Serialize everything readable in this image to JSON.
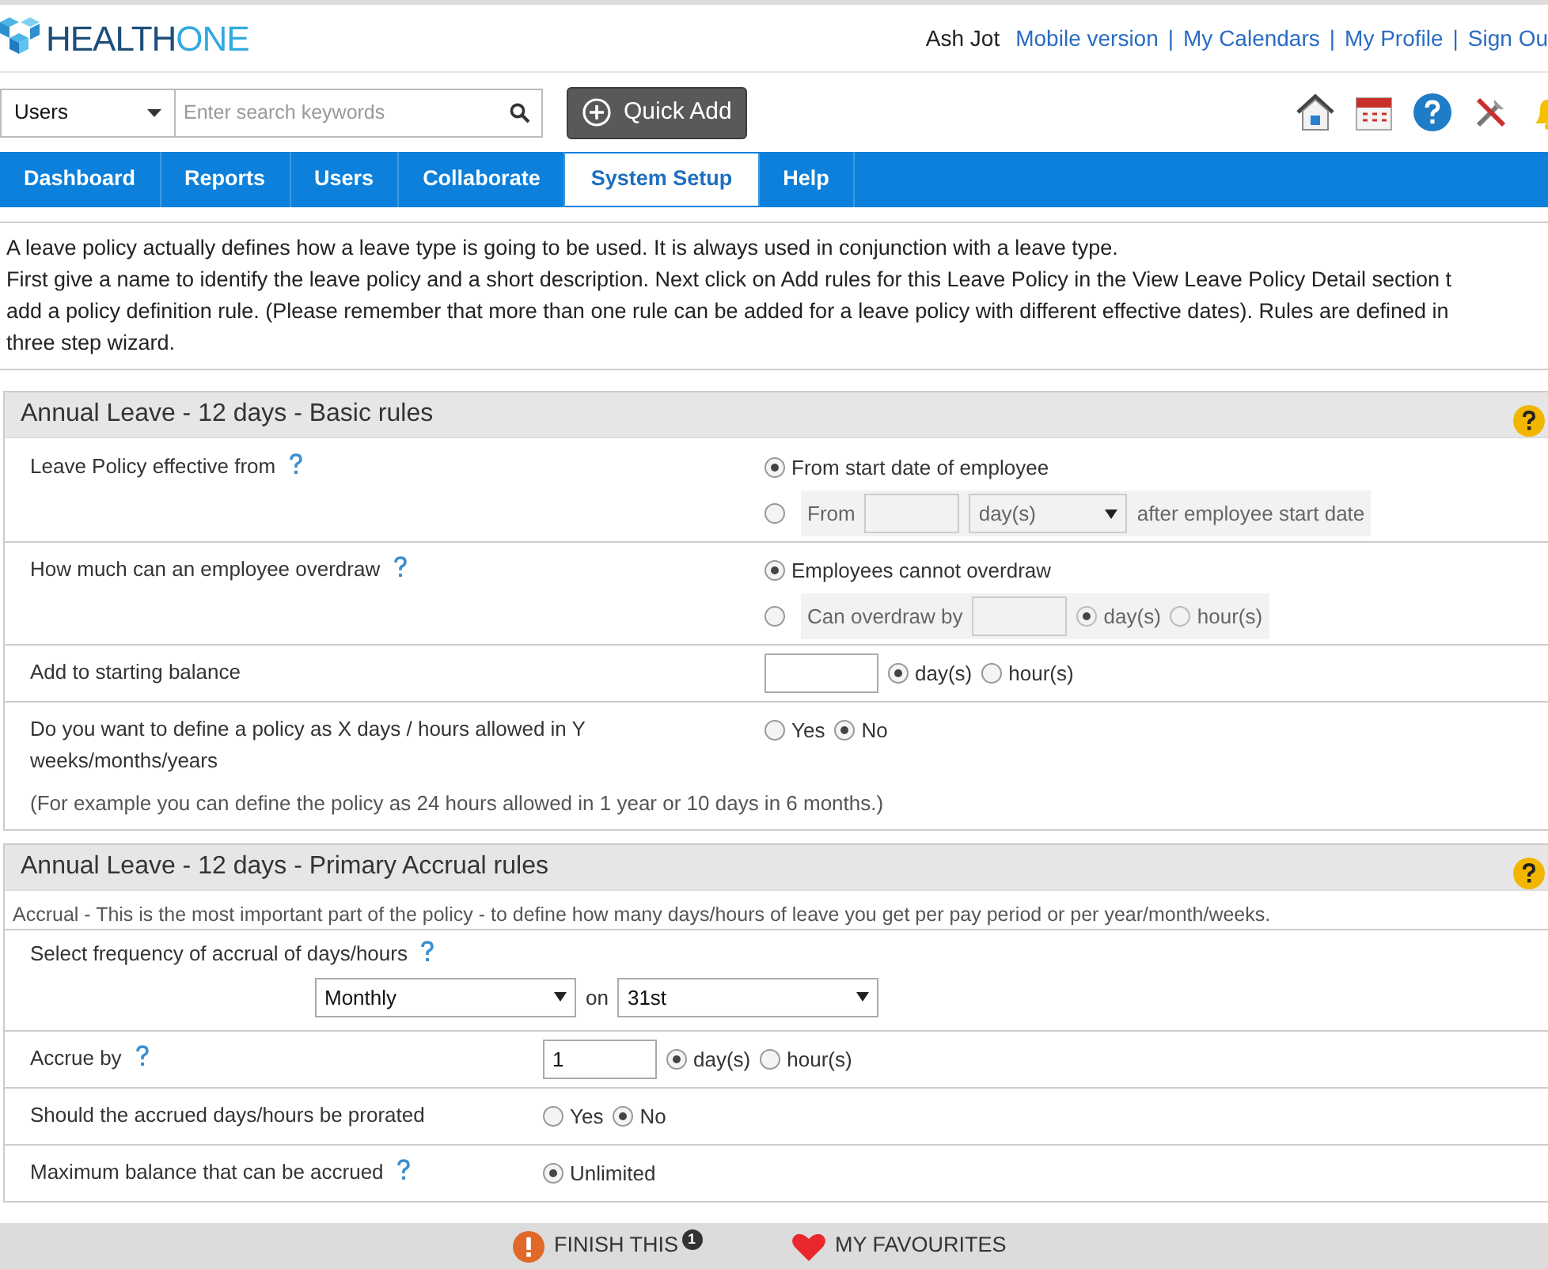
{
  "header": {
    "logo": {
      "part_1": "HEALTH",
      "part_2": "ONE"
    },
    "user_name": "Ash Jot",
    "separator": "|",
    "links": [
      "Mobile version",
      "My Calendars",
      "My Profile",
      "Sign Ou"
    ]
  },
  "search": {
    "scope": "Users",
    "placeholder": "Enter search keywords"
  },
  "quick_add": "Quick Add",
  "nav": [
    {
      "label": "Dashboard",
      "selected": false
    },
    {
      "label": "Reports",
      "selected": false
    },
    {
      "label": "Users",
      "selected": false
    },
    {
      "label": "Collaborate",
      "selected": false
    },
    {
      "label": "System Setup",
      "selected": true
    },
    {
      "label": "Help",
      "selected": false
    }
  ],
  "intro": [
    "A leave policy actually defines how a leave type is going to be used. It is always used in conjunction with a leave type.",
    "First give a name to identify the leave policy and a short description. Next click on Add rules for this Leave Policy in the View Leave Policy Detail section t",
    "add a policy definition rule. (Please remember that more than one rule can be added for a leave policy with different effective dates). Rules are defined in",
    "three step wizard."
  ],
  "sections": [
    {
      "kind": "basic",
      "title": "Annual Leave - 12 days - Basic rules",
      "rows": [
        {
          "kind": "inline",
          "label": "Leave Policy effective from",
          "help": true,
          "lines": [
            {
              "items": [
                {
                  "kind": "radio",
                  "selected": true,
                  "label": "From start date of employee"
                }
              ]
            },
            {
              "items": [
                {
                  "kind": "radio",
                  "selected": false
                }
              ],
              "boxed_items": [
                {
                  "kind": "text",
                  "text": "From"
                },
                {
                  "kind": "input"
                },
                {
                  "kind": "select",
                  "value": "day(s)"
                },
                {
                  "kind": "text",
                  "text": "after employee start date"
                }
              ]
            }
          ]
        },
        {
          "kind": "inline",
          "label": "How much can an employee overdraw",
          "help": true,
          "lines": [
            {
              "items": [
                {
                  "kind": "radio",
                  "selected": true,
                  "label": "Employees cannot overdraw"
                }
              ]
            },
            {
              "items": [
                {
                  "kind": "radio",
                  "selected": false
                }
              ],
              "boxed_items": [
                {
                  "kind": "text",
                  "text": "Can overdraw by"
                },
                {
                  "kind": "input"
                },
                {
                  "kind": "radio",
                  "selected": true,
                  "label": "day(s)"
                },
                {
                  "kind": "radio",
                  "selected": false,
                  "label": "hour(s)"
                }
              ]
            }
          ]
        },
        {
          "kind": "inline",
          "label": "Add to starting balance",
          "lines": [
            {
              "items": [
                {
                  "kind": "input"
                },
                {
                  "kind": "radio",
                  "selected": true,
                  "label": "day(s)"
                },
                {
                  "kind": "radio",
                  "selected": false,
                  "label": "hour(s)"
                }
              ]
            }
          ]
        },
        {
          "kind": "inline",
          "label": "Do you want to define a policy as X days / hours allowed in Y weeks/months/years",
          "note": "(For example you can define the policy as 24 hours allowed in 1 year or 10 days in 6 months.)",
          "lines": [
            {
              "items": [
                {
                  "kind": "radio",
                  "selected": false,
                  "label": "Yes"
                },
                {
                  "kind": "radio",
                  "selected": true,
                  "label": "No"
                }
              ]
            }
          ]
        }
      ]
    },
    {
      "kind": "accrual",
      "title": "Annual Leave - 12 days - Primary Accrual rules",
      "description": "Accrual - This is the most important part of the policy - to define how many days/hours of leave you get per pay period or per year/month/weeks.",
      "rows": [
        {
          "kind": "stacked",
          "label": "Select frequency of accrual of days/hours",
          "help": true,
          "lines": [
            {
              "items": [
                {
                  "kind": "select",
                  "value": "Monthly"
                },
                {
                  "kind": "text",
                  "text": "on"
                },
                {
                  "kind": "select",
                  "value": "31st"
                }
              ]
            }
          ]
        },
        {
          "kind": "inline",
          "label": "Accrue by",
          "help": true,
          "lines": [
            {
              "items": [
                {
                  "kind": "input",
                  "value": "1"
                },
                {
                  "kind": "radio",
                  "selected": true,
                  "label": "day(s)"
                },
                {
                  "kind": "radio",
                  "selected": false,
                  "label": "hour(s)"
                }
              ]
            }
          ]
        },
        {
          "kind": "inline",
          "label": "Should the accrued days/hours be prorated",
          "lines": [
            {
              "items": [
                {
                  "kind": "radio",
                  "selected": false,
                  "label": "Yes"
                },
                {
                  "kind": "radio",
                  "selected": true,
                  "label": "No"
                }
              ]
            }
          ]
        },
        {
          "kind": "inline",
          "label": "Maximum balance that can be accrued",
          "help": true,
          "lines": [
            {
              "items": [
                {
                  "kind": "radio",
                  "selected": true,
                  "label": "Unlimited"
                }
              ]
            }
          ]
        }
      ]
    }
  ],
  "footer": {
    "finish": "FINISH THIS",
    "finish_count": "1",
    "favourites": "MY FAVOURITES"
  }
}
